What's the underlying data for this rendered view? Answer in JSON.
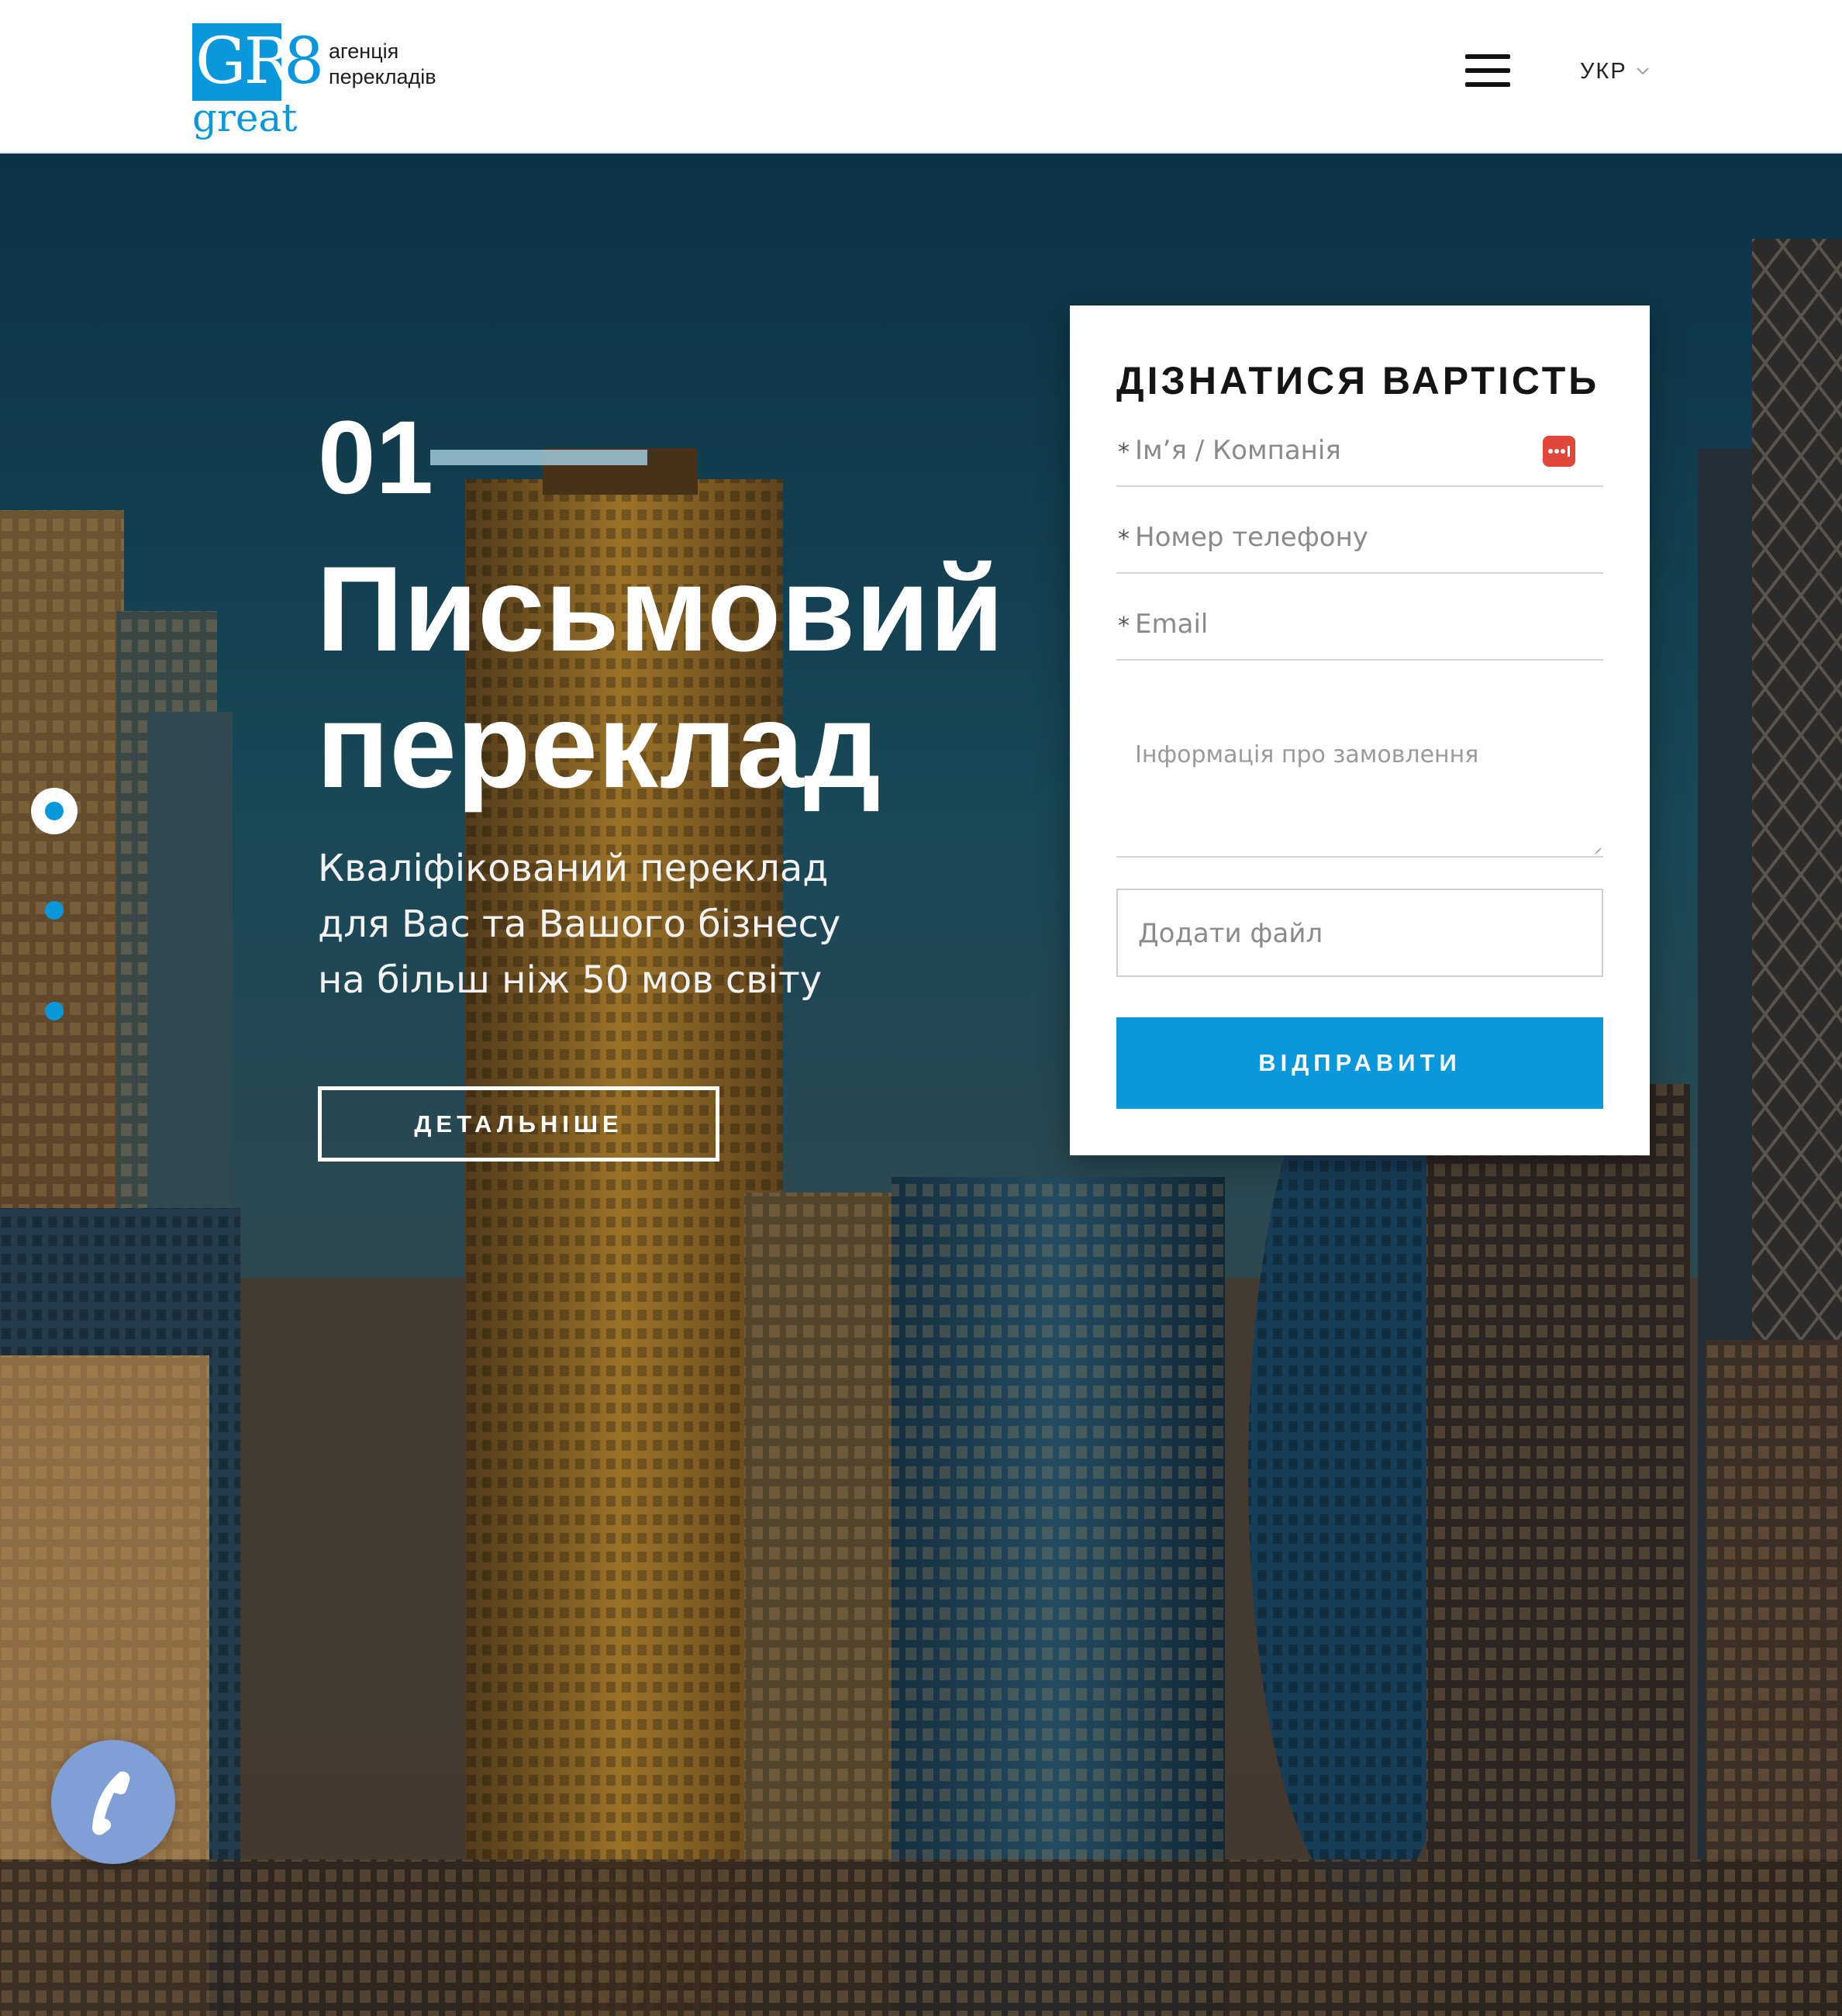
{
  "header": {
    "logo": {
      "mark_left": "GR",
      "mark_right": "8",
      "mark_bottom": "great",
      "tagline": [
        "агенція",
        "перекладів"
      ]
    },
    "menu_icon": "hamburger-menu-icon",
    "language": "УКР"
  },
  "hero": {
    "slide_number": "01",
    "title": [
      "Письмовий",
      "переклад"
    ],
    "subtitle": [
      "Кваліфікований переклад",
      "для Вас та Вашого бізнесу",
      "на більш ніж 50 мов світу"
    ],
    "more_button": "ДЕТАЛЬНІШЕ",
    "slides": {
      "count": 3,
      "active": 1
    },
    "call_icon": "phone-icon"
  },
  "form": {
    "title": "ДІЗНАТИСЯ ВАРТІСТЬ",
    "required_mark": "*",
    "name_placeholder": "Ім’я / Компанія",
    "phone_placeholder": "Номер телефону",
    "email_placeholder": "Email",
    "order_placeholder": "Інформація про замовлення",
    "file_label": "Додати файл",
    "submit_label": "ВІДПРАВИТИ"
  },
  "colors": {
    "brand_blue": "#0a98dc",
    "call_button": "#7f9fd6",
    "password_icon": "#e0463a"
  }
}
